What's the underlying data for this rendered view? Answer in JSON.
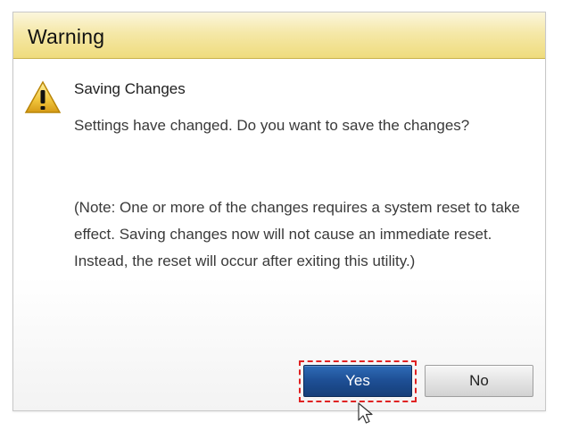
{
  "dialog": {
    "title": "Warning",
    "heading": "Saving Changes",
    "message": "Settings have changed. Do you want to save the changes?",
    "note": "(Note: One or more of the changes requires a system reset to take effect. Saving changes now will not cause an immediate reset. Instead, the reset will occur after exiting this utility.)"
  },
  "buttons": {
    "yes_label": "Yes",
    "no_label": "No"
  },
  "icons": {
    "warning": "warning-icon",
    "cursor": "mouse-cursor-icon"
  },
  "colors": {
    "title_bar": "#f5e8a8",
    "yes_button": "#1e4f95",
    "highlight": "#e02222"
  }
}
